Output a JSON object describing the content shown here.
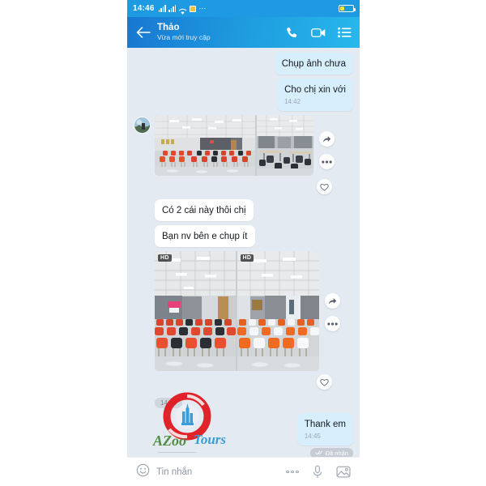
{
  "statusbar": {
    "time": "14:46",
    "icons": [
      "signal-bars-1",
      "signal-bars-2",
      "wifi-icon",
      "sim-icon",
      "overflow-dots"
    ],
    "battery_label": ""
  },
  "header": {
    "back_icon": "back-arrow-icon",
    "title": "Thảo",
    "subtitle": "Vừa mới truy cập",
    "actions": [
      {
        "name": "voice-call-icon",
        "label": ""
      },
      {
        "name": "video-call-icon",
        "label": ""
      },
      {
        "name": "menu-list-icon",
        "label": ""
      }
    ],
    "accent_start": "#1877d2",
    "accent_end": "#28b7ec"
  },
  "conversation": {
    "background": "#e4eaf1",
    "messages": [
      {
        "id": "m1",
        "direction": "out",
        "type": "text",
        "text": "Chụp ảnh chưa",
        "time": ""
      },
      {
        "id": "m2",
        "direction": "out",
        "type": "text",
        "text": "Cho chị xin với",
        "time": "14:42"
      },
      {
        "id": "m3",
        "direction": "in",
        "type": "photo-group",
        "photo_count": 2,
        "hd": false,
        "captions": [
          "meeting-room-red-chairs",
          "open-office-desks"
        ],
        "actions": [
          "share-icon",
          "more-options-icon",
          "heart-icon"
        ]
      },
      {
        "id": "m4",
        "direction": "in",
        "type": "text",
        "text": "Có 2 cái này thôi chị",
        "time": ""
      },
      {
        "id": "m5",
        "direction": "in",
        "type": "text",
        "text": "Bạn nv bên e chụp ít",
        "time": ""
      },
      {
        "id": "m6",
        "direction": "in",
        "type": "photo-group",
        "photo_count": 2,
        "hd": true,
        "hd_label": "HD",
        "captions": [
          "training-room-red-black-chairs",
          "training-room-orange-white-chairs"
        ],
        "actions": [
          "share-icon",
          "more-options-icon",
          "heart-icon"
        ],
        "time_pill": "14:44"
      },
      {
        "id": "m7",
        "direction": "out",
        "type": "text",
        "text": "Thank em",
        "time": "14:45",
        "receipt": "Đã nhận",
        "receipt_icon": "double-check-icon"
      }
    ],
    "bubble_out_color": "#d7effc",
    "bubble_in_color": "#ffffff"
  },
  "watermark": {
    "name": "azoo-tours-logo",
    "text_primary": "AZoo",
    "text_secondary": "Tours",
    "ring_color": "#e0181f",
    "building_color": "#2f9ad4"
  },
  "composer": {
    "emoji_icon": "emoji-smiley-icon",
    "placeholder": "Tin nhắn",
    "value": "",
    "icons": [
      {
        "name": "more-options-icon"
      },
      {
        "name": "microphone-icon"
      },
      {
        "name": "gallery-image-icon"
      }
    ]
  }
}
